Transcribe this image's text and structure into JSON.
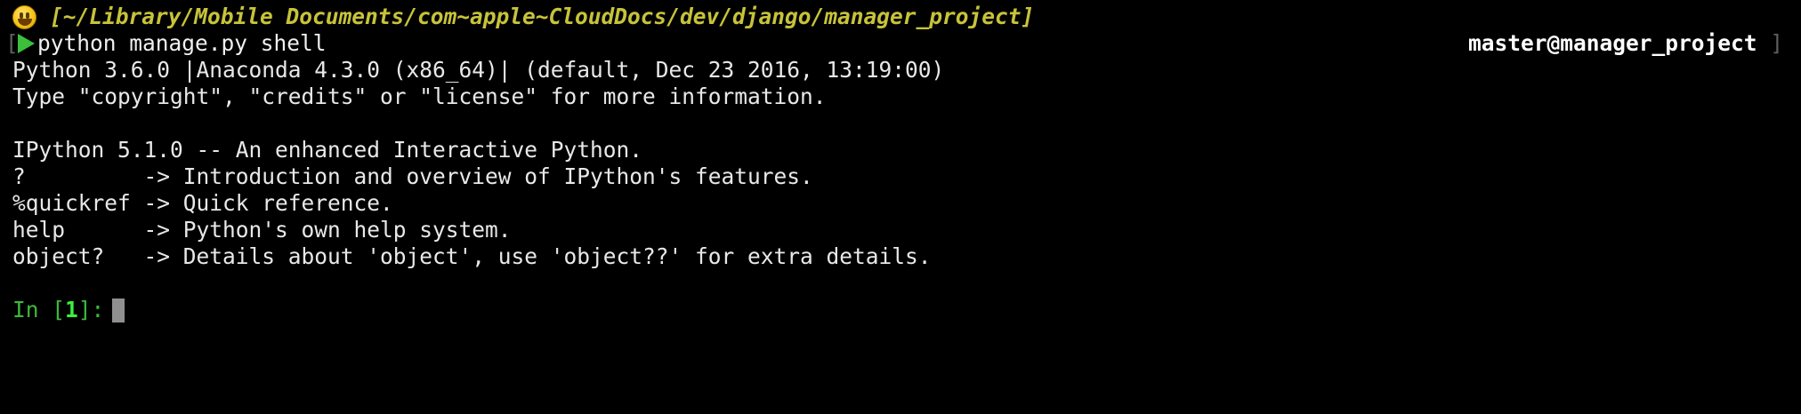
{
  "terminal": {
    "path": "[~/Library/Mobile Documents/com~apple~CloudDocs/dev/django/manager_project]",
    "command": "python manage.py shell",
    "prompt_bracket": "[",
    "right_prompt": "master@manager_project",
    "right_prompt_bracket": "]",
    "output_lines": [
      "Python 3.6.0 |Anaconda 4.3.0 (x86_64)| (default, Dec 23 2016, 13:19:00)",
      "Type \"copyright\", \"credits\" or \"license\" for more information.",
      "",
      "IPython 5.1.0 -- An enhanced Interactive Python.",
      "?         -> Introduction and overview of IPython's features.",
      "%quickref -> Quick reference.",
      "help      -> Python's own help system.",
      "object?   -> Details about 'object', use 'object??' for extra details."
    ],
    "in_prompt": {
      "prefix": "In [",
      "number": "1",
      "suffix": "]: "
    },
    "icons": {
      "status": "grinning-face-icon",
      "prompt": "play-triangle-icon",
      "cursor": "block-cursor"
    },
    "colors": {
      "background": "#000000",
      "path": "#c7c33a",
      "prompt_arrow": "#3cc03c",
      "in_prompt": "#3cb83c",
      "text": "#e8e8e8"
    }
  }
}
